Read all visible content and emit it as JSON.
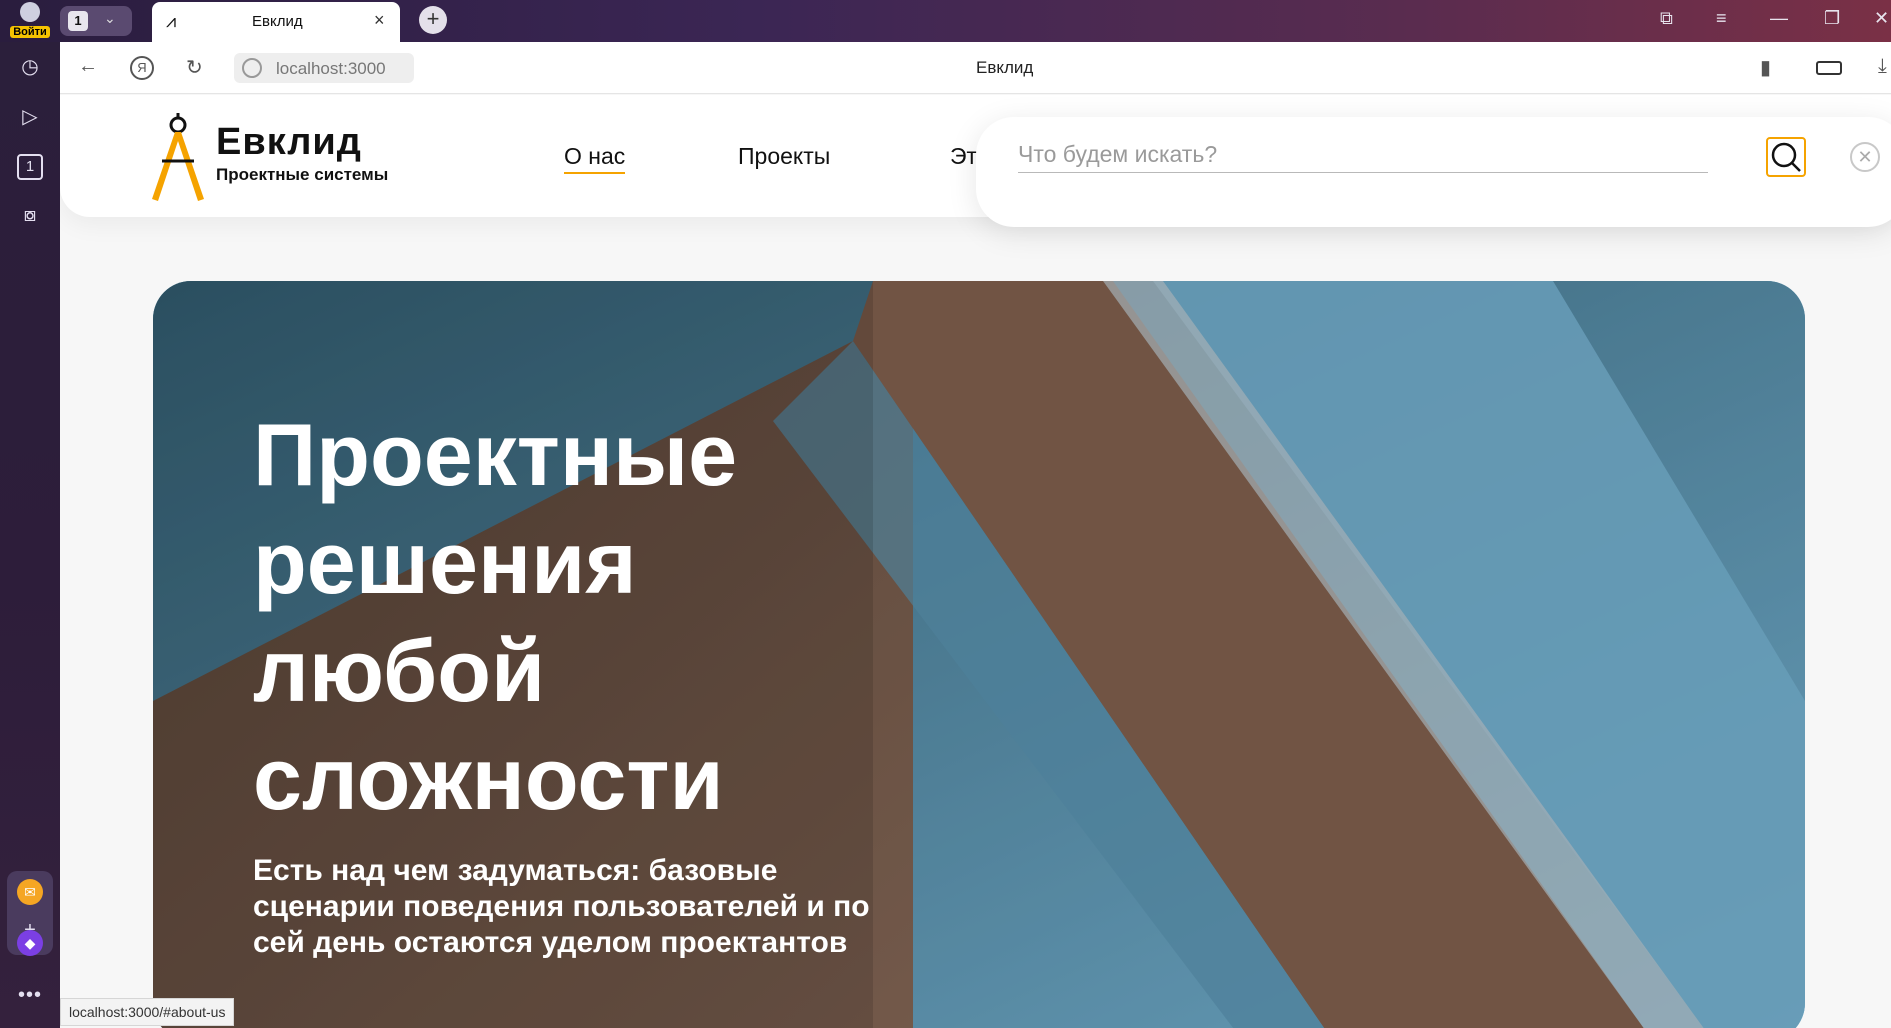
{
  "browser": {
    "profile_label": "Войти",
    "tab_count": "1",
    "tab_title": "Евклид",
    "url": "localhost:3000",
    "page_title": "Евклид",
    "status_url": "localhost:3000/#about-us",
    "sidebar_badge": "1"
  },
  "site": {
    "brand": "Евклид",
    "tagline": "Проектные системы",
    "nav": [
      "О нас",
      "Проекты",
      "Эт"
    ],
    "search": {
      "placeholder": "Что будем искать?"
    },
    "hero": {
      "headline": "Проектные решения любой сложности",
      "subtitle": "Есть над чем задуматься: базовые сценарии поведения пользователей и по сей день остаются уделом проектантов"
    }
  },
  "colors": {
    "accent": "#f5a300",
    "window_gradient_start": "#2a1d3e",
    "window_gradient_end": "#7a3046"
  }
}
